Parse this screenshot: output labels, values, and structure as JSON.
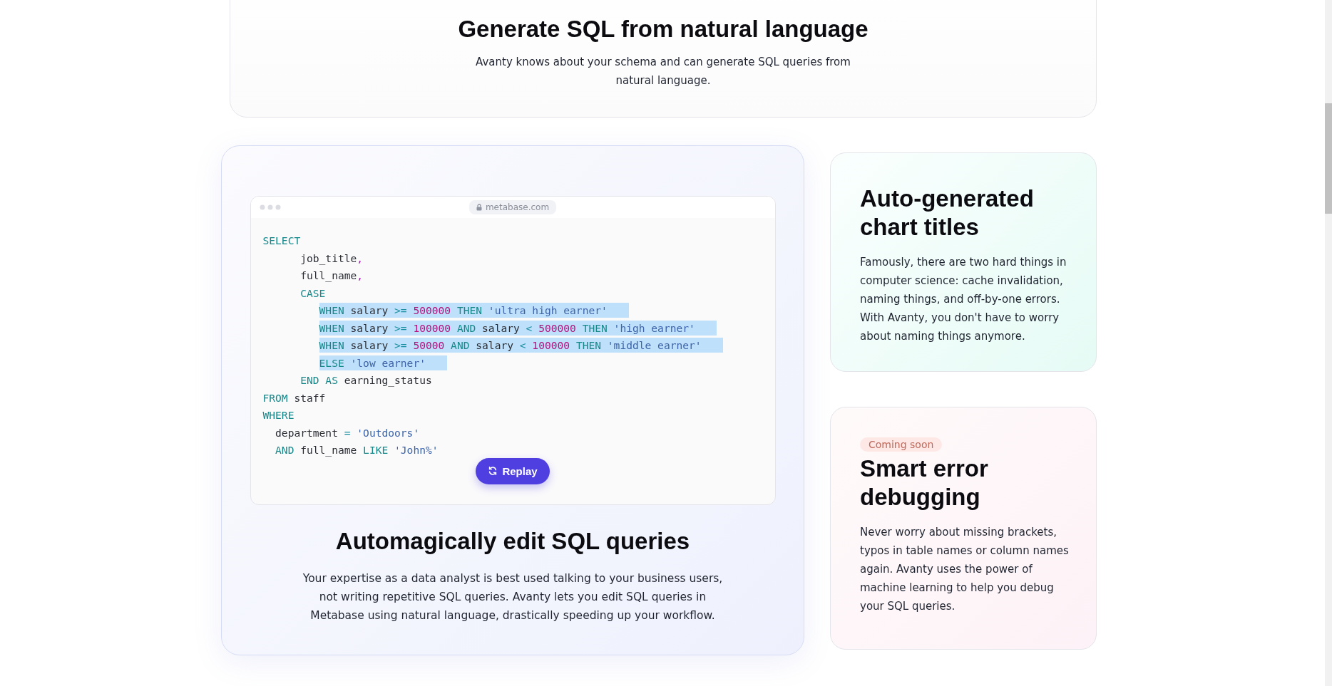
{
  "top_feature": {
    "title": "Generate SQL from natural language",
    "description": "Avanty knows about your schema and can generate SQL queries from natural language."
  },
  "editor_feature": {
    "browser": {
      "url": "metabase.com"
    },
    "code_lines": [
      {
        "selected": false,
        "tokens": [
          {
            "kind": "keyword",
            "text": "SELECT"
          }
        ]
      },
      {
        "selected": false,
        "tokens": [
          {
            "kind": "plain",
            "text": "      job_title"
          },
          {
            "kind": "punct",
            "text": ","
          }
        ]
      },
      {
        "selected": false,
        "tokens": [
          {
            "kind": "plain",
            "text": "      full_name"
          },
          {
            "kind": "punct",
            "text": ","
          }
        ]
      },
      {
        "selected": false,
        "tokens": [
          {
            "kind": "keyword",
            "text": "      CASE"
          }
        ]
      },
      {
        "selected": true,
        "tokens": [
          {
            "kind": "keyword",
            "text": "         WHEN"
          },
          {
            "kind": "plain",
            "text": " salary "
          },
          {
            "kind": "operator",
            "text": ">="
          },
          {
            "kind": "number",
            "text": " 500000"
          },
          {
            "kind": "keyword",
            "text": " THEN"
          },
          {
            "kind": "string",
            "text": " 'ultra high earner'"
          }
        ]
      },
      {
        "selected": true,
        "tokens": [
          {
            "kind": "keyword",
            "text": "         WHEN"
          },
          {
            "kind": "plain",
            "text": " salary "
          },
          {
            "kind": "operator",
            "text": ">="
          },
          {
            "kind": "number",
            "text": " 100000"
          },
          {
            "kind": "keyword",
            "text": " AND"
          },
          {
            "kind": "plain",
            "text": " salary "
          },
          {
            "kind": "operator",
            "text": "<"
          },
          {
            "kind": "number",
            "text": " 500000"
          },
          {
            "kind": "keyword",
            "text": " THEN"
          },
          {
            "kind": "string",
            "text": " 'high earner'"
          }
        ]
      },
      {
        "selected": true,
        "tokens": [
          {
            "kind": "keyword",
            "text": "         WHEN"
          },
          {
            "kind": "plain",
            "text": " salary "
          },
          {
            "kind": "operator",
            "text": ">="
          },
          {
            "kind": "number",
            "text": " 50000"
          },
          {
            "kind": "keyword",
            "text": " AND"
          },
          {
            "kind": "plain",
            "text": " salary "
          },
          {
            "kind": "operator",
            "text": "<"
          },
          {
            "kind": "number",
            "text": " 100000"
          },
          {
            "kind": "keyword",
            "text": " THEN"
          },
          {
            "kind": "string",
            "text": " 'middle earner'"
          }
        ]
      },
      {
        "selected": true,
        "tokens": [
          {
            "kind": "keyword",
            "text": "         ELSE"
          },
          {
            "kind": "string",
            "text": " 'low earner'"
          }
        ]
      },
      {
        "selected": false,
        "tokens": [
          {
            "kind": "keyword",
            "text": "      END AS"
          },
          {
            "kind": "plain",
            "text": " earning_status"
          }
        ]
      },
      {
        "selected": false,
        "tokens": [
          {
            "kind": "keyword",
            "text": "FROM"
          },
          {
            "kind": "plain",
            "text": " staff"
          }
        ]
      },
      {
        "selected": false,
        "tokens": [
          {
            "kind": "keyword",
            "text": "WHERE"
          }
        ]
      },
      {
        "selected": false,
        "tokens": [
          {
            "kind": "plain",
            "text": "  department "
          },
          {
            "kind": "operator",
            "text": "="
          },
          {
            "kind": "string",
            "text": " 'Outdoors'"
          }
        ]
      },
      {
        "selected": false,
        "tokens": [
          {
            "kind": "keyword",
            "text": "  AND"
          },
          {
            "kind": "plain",
            "text": " full_name "
          },
          {
            "kind": "keyword",
            "text": "LIKE"
          },
          {
            "kind": "string",
            "text": " 'John%'"
          }
        ]
      }
    ],
    "replay_button": "Replay",
    "title": "Automagically edit SQL queries",
    "description": "Your expertise as a data analyst is best used talking to your business users, not writing repetitive SQL queries. Avanty lets you edit SQL queries in Metabase using natural language, drastically speeding up your workflow."
  },
  "side_features": [
    {
      "kind": "available",
      "title": "Auto-generated chart titles",
      "description": "Famously, there are two hard things in computer science: cache invalidation, naming things, and off-by-one errors. With Avanty, you don't have to worry about naming things anymore."
    },
    {
      "kind": "soon",
      "badge": "Coming soon",
      "title": "Smart error debugging",
      "description": "Never worry about missing brackets, typos in table names or column names again. Avanty uses the power of machine learning to help you debug your SQL queries."
    }
  ]
}
